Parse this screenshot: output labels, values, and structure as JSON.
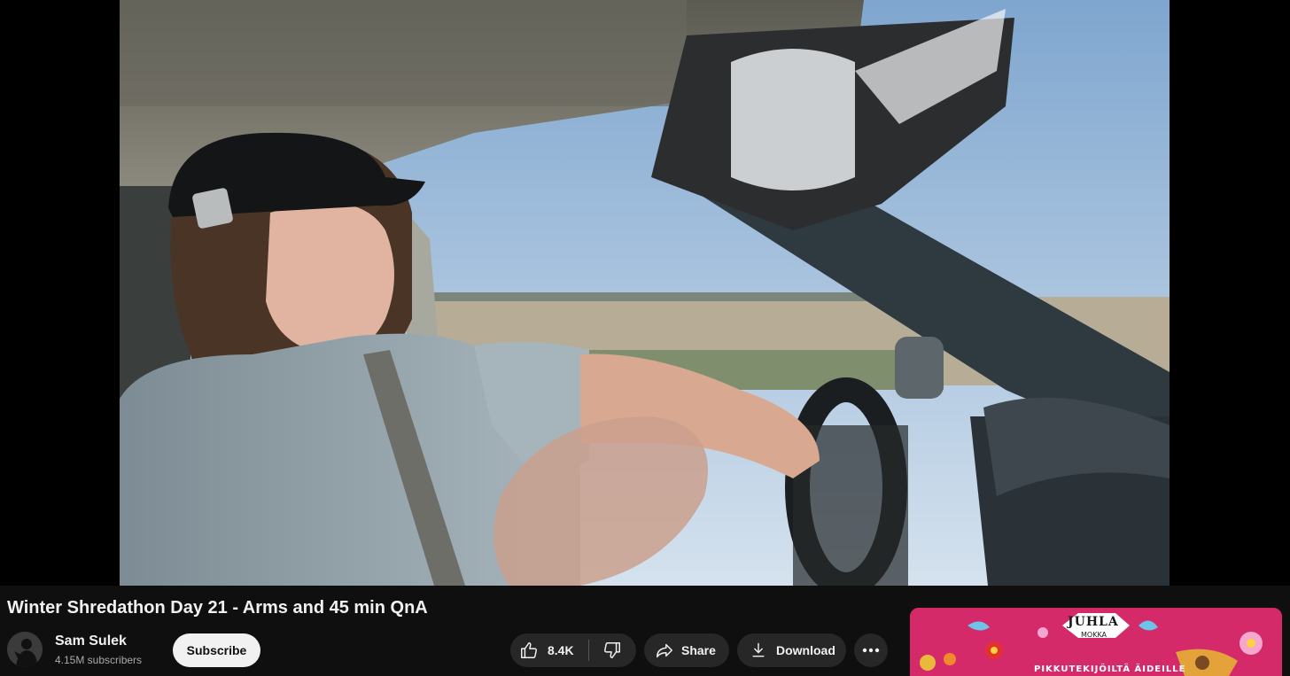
{
  "video": {
    "title": "Winter Shredathon Day 21 - Arms and 45 min QnA"
  },
  "channel": {
    "name": "Sam Sulek",
    "subscribers": "4.15M subscribers",
    "subscribe_label": "Subscribe"
  },
  "actions": {
    "like_count": "8.4K",
    "share_label": "Share",
    "download_label": "Download"
  },
  "ad": {
    "brand": "JUHLA",
    "brand_sub": "MOKKA",
    "tagline": "PIKKUTEKIJÖILTÄ ÄIDEILLE"
  },
  "icons": {
    "like": "thumbs-up-icon",
    "dislike": "thumbs-down-icon",
    "share": "share-arrow-icon",
    "download": "download-icon",
    "more": "more-horizontal-icon"
  },
  "colors": {
    "background": "#0f0f0f",
    "pill": "#272727",
    "subscribe_bg": "#f1f1f1",
    "ad_bg": "#d42a6a"
  }
}
